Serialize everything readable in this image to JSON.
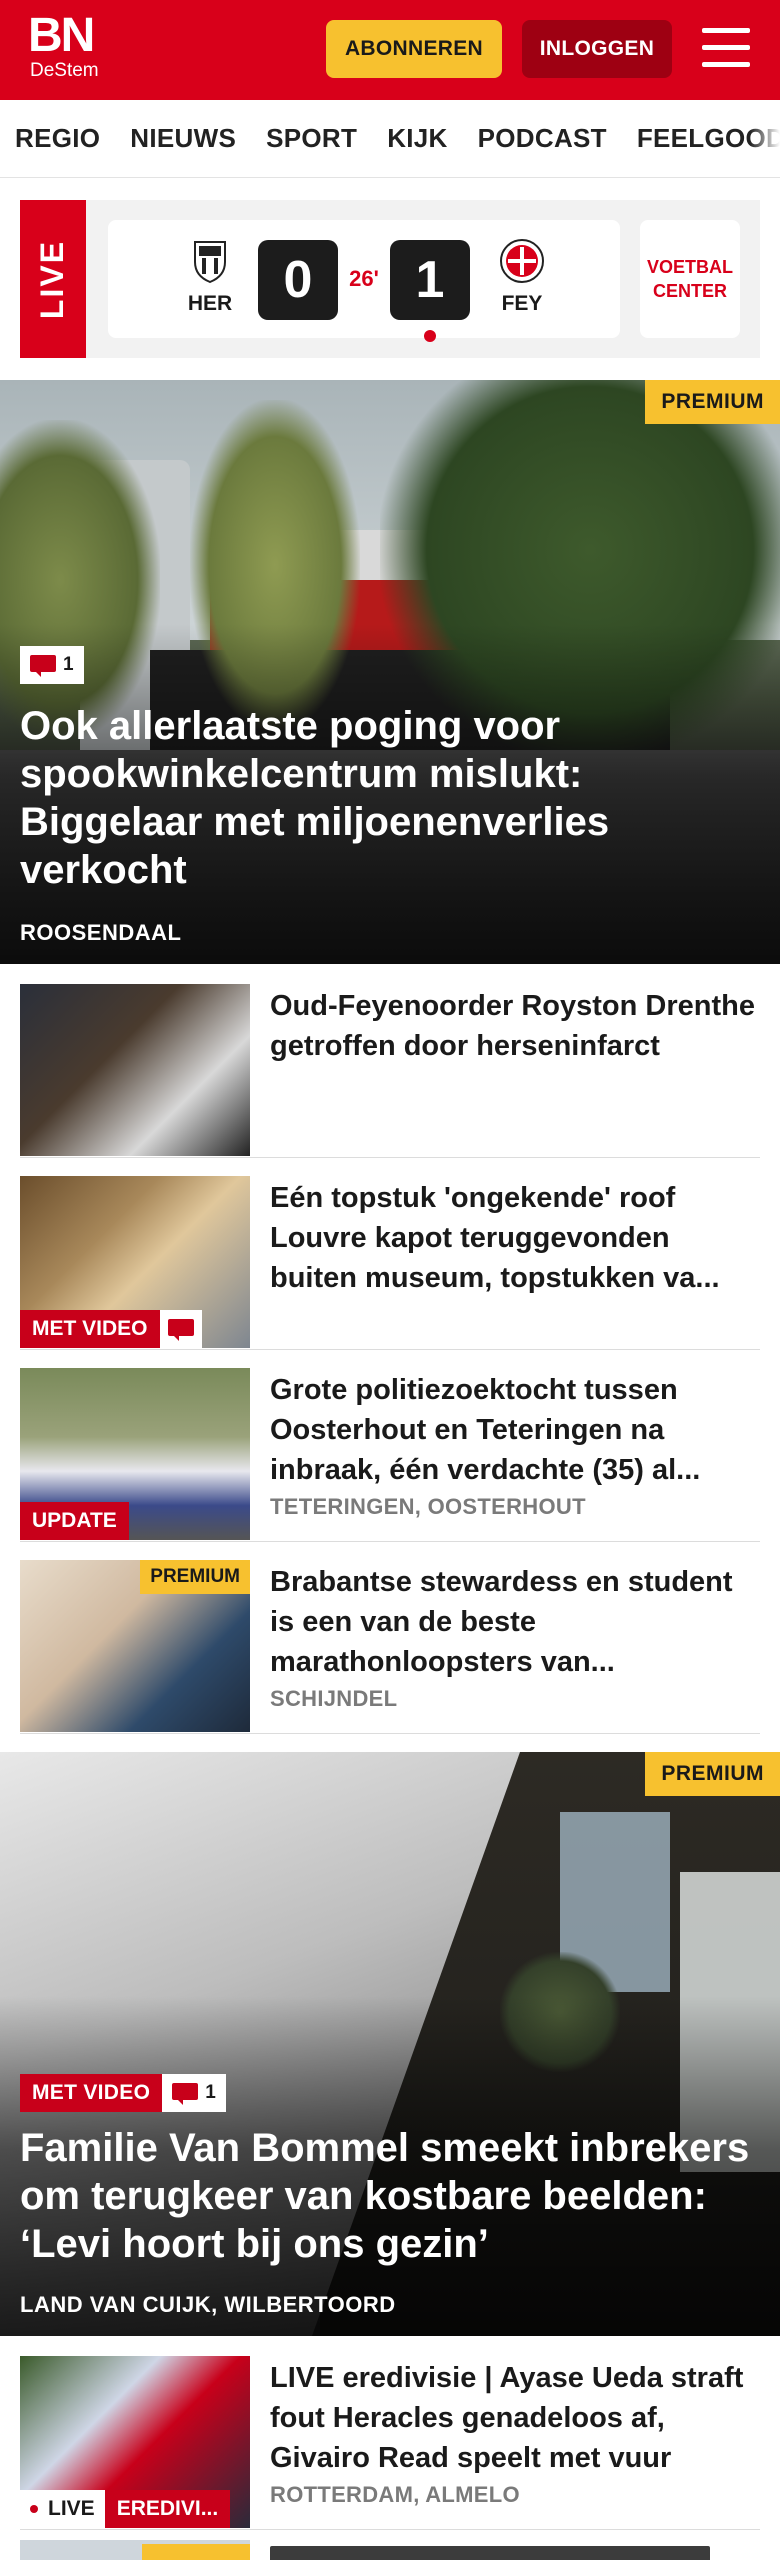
{
  "header": {
    "logo_main": "BN",
    "logo_sub": "DeStem",
    "subscribe_label": "ABONNEREN",
    "login_label": "INLOGGEN"
  },
  "nav": {
    "items": [
      "REGIO",
      "NIEUWS",
      "SPORT",
      "KIJK",
      "PODCAST",
      "FEELGOOD"
    ]
  },
  "live_score": {
    "tag": "LIVE",
    "home_team": "HER",
    "away_team": "FEY",
    "home_score": "0",
    "away_score": "1",
    "minute": "26'",
    "voetbal_center": "VOETBAL CENTER"
  },
  "hero_1": {
    "premium": "PREMIUM",
    "comments": "1",
    "title": "Ook allerlaatste poging voor spookwinkelcentrum mislukt: Biggelaar met miljoenenverlies verkocht",
    "location": "ROOSENDAAL"
  },
  "list_1": [
    {
      "title": "Oud-Feyenoorder Royston Drenthe getroffen door hersen­infarct",
      "location": ""
    },
    {
      "title": "Eén topstuk 'ongekende' roof Louvre kapot teruggevonden buiten museum, topstukken va...",
      "badge": "MET VIDEO",
      "location": ""
    },
    {
      "title": "Grote politiezoektocht tussen Oosterhout en Teteringen na inbraak, één verdachte (35) al...",
      "badge": "UPDATE",
      "location": "TETERINGEN, OOSTERHOUT"
    },
    {
      "title": "Brabantse stewardess en student is een van de beste marathonloopsters van...",
      "premium": "PREMIUM",
      "location": "SCHIJNDEL"
    }
  ],
  "hero_2": {
    "premium": "PREMIUM",
    "badge": "MET VIDEO",
    "comments": "1",
    "title": "Familie Van Bommel smeekt inbrekers om terugkeer van kostbare beelden: ‘Levi hoort bij ons gezin’",
    "location": "LAND VAN CUIJK, WILBERTOORD"
  },
  "list_2": [
    {
      "title": "LIVE eredivisie | Ayase Ueda straft fout Heracles genadeloos af, Givairo Read speelt met vuur",
      "live": "LIVE",
      "badge": "EREDIVI...",
      "location": "ROTTERDAM, ALMELO"
    }
  ],
  "colors": {
    "brand_red": "#d8001a",
    "premium_yellow": "#f7c12f",
    "login_dark_red": "#9e0012"
  }
}
